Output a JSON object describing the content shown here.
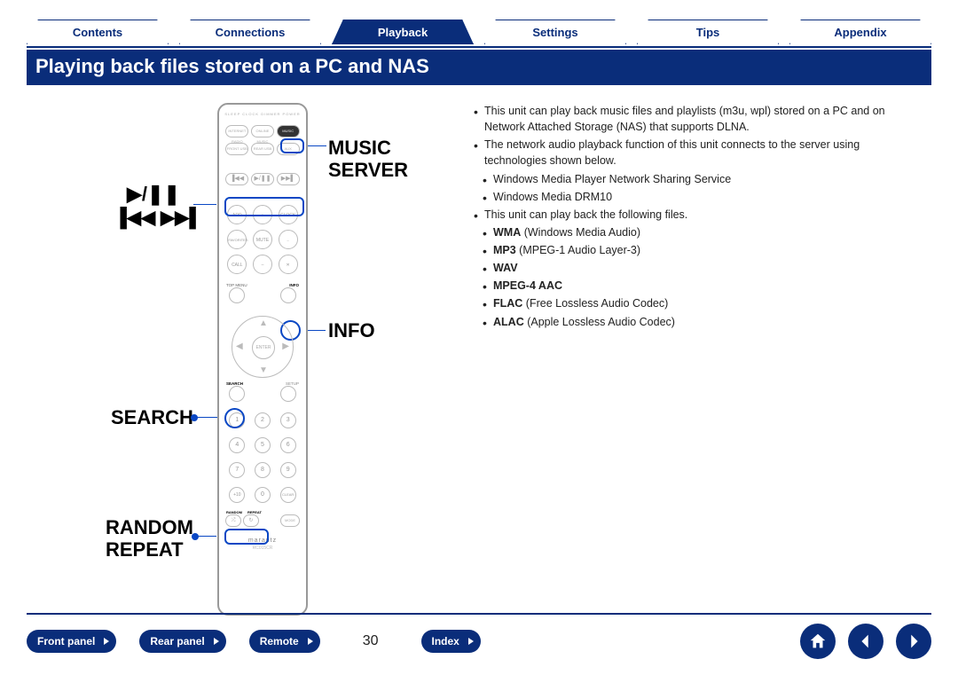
{
  "nav": {
    "tabs": [
      "Contents",
      "Connections",
      "Playback",
      "Settings",
      "Tips",
      "Appendix"
    ],
    "active_index": 2
  },
  "title": "Playing back files stored on a PC and NAS",
  "callouts": {
    "music_server": "MUSIC\nSERVER",
    "transport_playpause": "▶/❚❚",
    "transport_skip": "▐◀◀ ▶▶▌",
    "info": "INFO",
    "search": "SEARCH",
    "random_repeat": "RANDOM\nREPEAT"
  },
  "remote": {
    "top_labels": "SLEEP   CLOCK   DIMMER   POWER",
    "row2": [
      "INTERNET RADIO",
      "ONLINE MUSIC",
      "MUSIC SERVER"
    ],
    "row3": [
      "FRONT USB",
      "REAR USB",
      "AUX"
    ],
    "add": "ADD",
    "volup": "VOL+",
    "clock": "CLOCK",
    "fav": "FAVORITES",
    "mute": "MUTE",
    "voldn": "VOL–",
    "call": "CALL",
    "topmenu": "TOP MENU",
    "info_btn": "INFO",
    "enter": "ENTER",
    "search_btn": "SEARCH",
    "setup": "SETUP",
    "nums": [
      "1",
      "2",
      "3",
      "4",
      "5",
      "6",
      "7",
      "8",
      "9",
      "+10",
      "0",
      "CLEAR"
    ],
    "random": "RANDOM",
    "repeat": "REPEAT",
    "mode": "MODE",
    "brand": "marantz",
    "model": "RC015CR"
  },
  "body": {
    "b1": "This unit can play back music files and playlists (m3u, wpl) stored on a PC and on Network Attached Storage (NAS) that supports DLNA.",
    "b2": "The network audio playback function of this unit connects to the server using technologies shown below.",
    "b2a": "Windows Media Player Network Sharing Service",
    "b2b": "Windows Media DRM10",
    "b3": "This unit can play back the following files.",
    "f_wma_b": "WMA",
    "f_wma_t": " (Windows Media Audio)",
    "f_mp3_b": "MP3",
    "f_mp3_t": " (MPEG-1 Audio Layer-3)",
    "f_wav": "WAV",
    "f_aac": "MPEG-4 AAC",
    "f_flac_b": "FLAC",
    "f_flac_t": " (Free Lossless Audio Codec)",
    "f_alac_b": "ALAC",
    "f_alac_t": " (Apple Lossless Audio Codec)"
  },
  "footer": {
    "buttons": [
      "Front panel",
      "Rear panel",
      "Remote",
      "Index"
    ],
    "page": "30"
  }
}
